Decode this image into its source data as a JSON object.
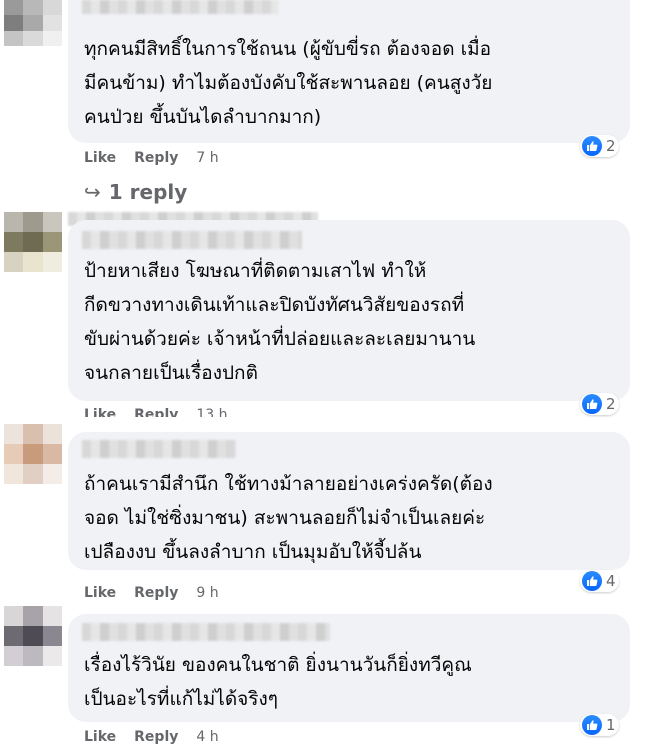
{
  "comments": [
    {
      "lines": [
        "ทุกคนมีสิทธิ์ในการใช้ถนน (ผู้ขับขี่รถ ต้องจอด เมื่อ",
        "มีคนข้าม) ทำไมต้องบังคับใช้สะพานลอย (คนสูงวัย",
        "คนป่วย ขึ้นบันไดลำบากมาก)"
      ],
      "like_label": "Like",
      "reply_label": "Reply",
      "time": "7 h",
      "reactions": "2",
      "reply_count_label": "1 reply"
    },
    {
      "lines": [
        "ป้ายหาเสียง โฆษณาที่ติดตามเสาไฟ ทำให้",
        "กีดขวางทางเดินเท้าและปิดบังทัศนวิสัยของรถที่",
        "ขับผ่านด้วยค่ะ เจ้าหน้าที่ปล่อยและละเลยมานาน",
        "จนกลายเป็นเรื่องปกติ"
      ],
      "like_label": "Like",
      "reply_label": "Reply",
      "time": "13 h",
      "reactions": "2"
    },
    {
      "lines": [
        "ถ้าคนเรามีสำนึก ใช้ทางม้าลายอย่างเคร่งครัด(ต้อง",
        "จอด ไม่ใช่ซิ่งมาชน) สะพานลอยก็ไม่จำเป็นเลยค่ะ",
        "เปลืองงบ ขึ้นลงลำบาก เป็นมุมอับให้จี้ปล้น"
      ],
      "like_label": "Like",
      "reply_label": "Reply",
      "time": "9 h",
      "reactions": "4"
    },
    {
      "lines": [
        "เรื่องไร้วินัย ของคนในชาติ ยิ่งนานวันก็ยิ่งทวีคูณ",
        "เป็นอะไรที่แก้ไม่ได้จริงๆ"
      ],
      "like_label": "Like",
      "reply_label": "Reply",
      "time": "4 h",
      "reactions": "1"
    }
  ],
  "icons": {
    "reaction": "like-icon",
    "reply_arrow": "reply-arrow-icon",
    "avatar": "blurred-avatar"
  },
  "colors": {
    "bubble": "#f0f2f5",
    "like_blue": "#0866ff",
    "meta_text": "#65676b",
    "body_text": "#050505"
  }
}
